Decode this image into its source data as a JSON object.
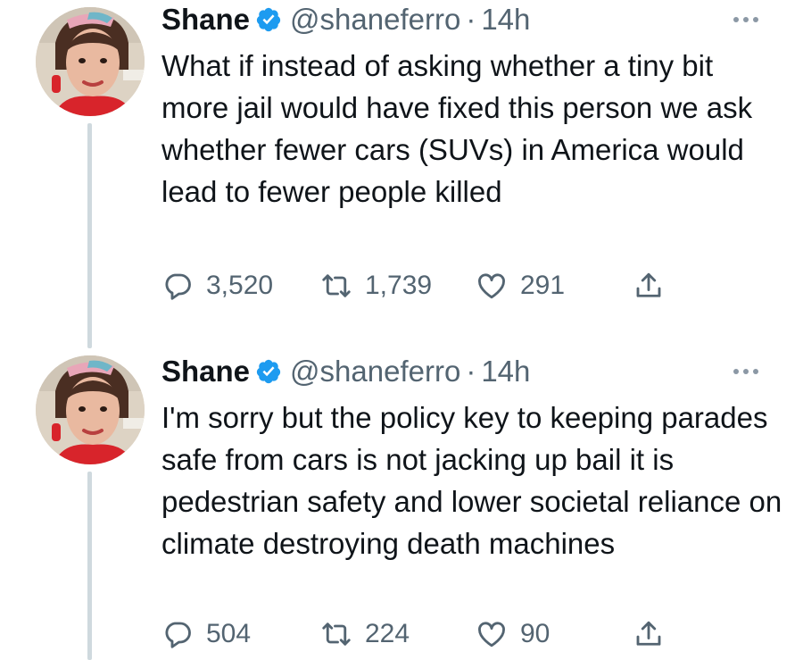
{
  "tweets": [
    {
      "author": "Shane",
      "handle": "@shaneferro",
      "separator": "·",
      "time": "14h",
      "text": "What if instead of asking whether a tiny bit more jail would have fixed this person we ask whether fewer cars (SUVs) in America would lead to fewer people killed",
      "replies": "3,520",
      "retweets": "1,739",
      "likes": "291"
    },
    {
      "author": "Shane",
      "handle": "@shaneferro",
      "separator": "·",
      "time": "14h",
      "text": "I'm sorry but the policy key to keeping parades safe from cars is not jacking up bail it is pedestrian safety and lower societal reliance on climate destroying death machines",
      "replies": "504",
      "retweets": "224",
      "likes": "90"
    }
  ],
  "colors": {
    "verified": "#1d9bf0",
    "muted": "#536471",
    "thread_line": "#cfd9de"
  },
  "icons": [
    "verified-badge-icon",
    "more-icon",
    "reply-icon",
    "retweet-icon",
    "like-icon",
    "share-icon"
  ]
}
